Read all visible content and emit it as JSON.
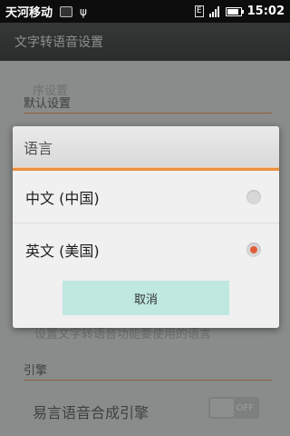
{
  "status_bar": {
    "carrier": "天河移动",
    "network_type": "E",
    "time": "15:02",
    "icons": [
      "sim-card-icon",
      "usb-icon",
      "network-type-icon",
      "signal-icon",
      "battery-icon"
    ]
  },
  "app": {
    "title": "文字转语音设置"
  },
  "settings": {
    "faint_top_text": "序设置",
    "default_section": "默认设置",
    "language_summary": "设置文字转语音功能要使用的语言",
    "engine_section": "引擎",
    "engine_name": "易言语音合成引擎",
    "engine_toggle": "OFF"
  },
  "dialog": {
    "title": "语言",
    "options": [
      {
        "label": "中文 (中国)",
        "checked": false
      },
      {
        "label": "英文 (美国)",
        "checked": true
      }
    ],
    "cancel_label": "取消"
  },
  "colors": {
    "accent_orange": "#eb8f3e",
    "radio_selected": "#e35d3a",
    "cancel_button": "#bfe8e1"
  }
}
